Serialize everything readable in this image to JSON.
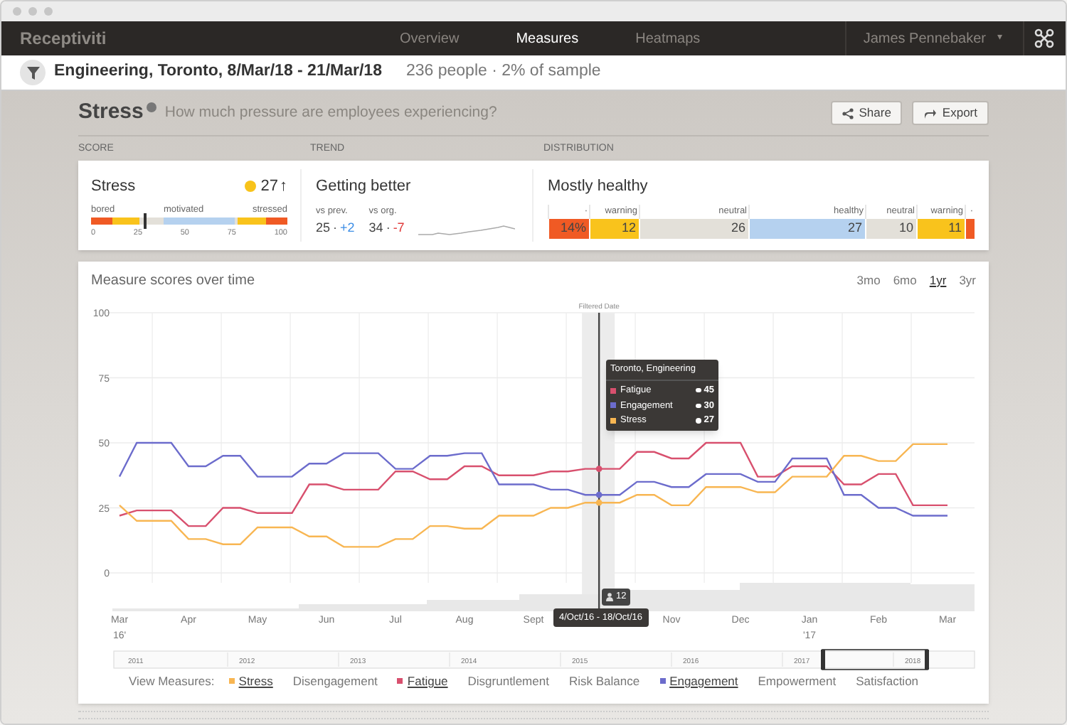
{
  "nav": {
    "logo": "Receptiviti",
    "tabs": [
      {
        "label": "Overview",
        "selected": false
      },
      {
        "label": "Measures",
        "selected": true
      },
      {
        "label": "Heatmaps",
        "selected": false
      }
    ],
    "user": "James Pennebaker",
    "caret": "▾"
  },
  "filter_bar": {
    "title": "Engineering, Toronto, 8/Mar/18 - 21/Mar/18",
    "summary": "236 people · 2% of sample"
  },
  "header": {
    "title": "Stress",
    "subtitle": "How much pressure are employees experiencing?",
    "buttons": [
      {
        "kind": "share",
        "label": "Share"
      },
      {
        "kind": "export",
        "label": "Export"
      }
    ]
  },
  "sections": [
    "SCORE",
    "TREND",
    "DISTRIBUTION"
  ],
  "score": {
    "title": "Stress",
    "value": "27",
    "arrow": "↑",
    "color": "#f8c31a",
    "labels": [
      "bored",
      "motivated",
      "stressed"
    ],
    "level": 0.27,
    "ticks": [
      "0",
      "25",
      "50",
      "75",
      "100"
    ]
  },
  "trend": {
    "title": "Getting better",
    "comparisons": [
      {
        "label": "vs prev.",
        "value": "25",
        "separator": "·",
        "delta": "+2",
        "color": "#3d8ee6"
      },
      {
        "label": "vs org.",
        "value": "34",
        "separator": "·",
        "delta": "-7",
        "color": "#e03b3b"
      }
    ]
  },
  "distribution": {
    "title": "Mostly healthy",
    "segments": [
      {
        "label": "·",
        "value": "14%",
        "color": "#f05a24"
      },
      {
        "label": "warning",
        "value": "12",
        "color": "#f9c31c"
      },
      {
        "label": "neutral",
        "value": "26",
        "color": "#e3e0d9"
      },
      {
        "label": "healthy",
        "value": "27",
        "color": "#b5d1ef"
      },
      {
        "label": "neutral",
        "value": "10",
        "color": "#e3e0d9"
      },
      {
        "label": "warning",
        "value": "11",
        "color": "#f9c31c"
      },
      {
        "label": "·",
        "color": "#f05a24"
      }
    ]
  },
  "chart": {
    "title": "Measure scores over time",
    "ranges": [
      {
        "label": "3mo",
        "selected": false
      },
      {
        "label": "6mo",
        "selected": false
      },
      {
        "label": "1yr",
        "selected": true
      },
      {
        "label": "3yr",
        "selected": false
      }
    ],
    "chart_data": {
      "type": "line",
      "categories": [
        "Mar",
        null,
        null,
        null,
        "Apr",
        null,
        null,
        null,
        "May",
        null,
        null,
        null,
        "Jun",
        null,
        null,
        null,
        "Jul",
        null,
        null,
        null,
        "Aug",
        null,
        null,
        null,
        "Sept",
        null,
        null,
        null,
        null,
        null,
        null,
        null,
        "Nov",
        null,
        null,
        null,
        "Dec",
        null,
        null,
        null,
        "Jan",
        null,
        null,
        null,
        "Feb",
        null,
        null,
        null,
        "Mar"
      ],
      "series": [
        {
          "name": "Fatigue",
          "color": "#d8506e",
          "values": [
            22,
            24,
            24,
            24,
            18,
            18,
            25,
            25,
            23,
            23,
            23,
            34,
            34,
            32,
            32,
            32,
            39,
            39,
            36,
            36,
            41,
            41,
            37.5,
            37.5,
            37.5,
            39,
            39,
            40,
            40,
            40,
            46.5,
            46.5,
            44,
            44,
            50,
            50,
            50,
            37,
            37,
            41,
            41,
            41,
            34,
            34,
            38,
            38,
            26,
            26,
            26
          ]
        },
        {
          "name": "Engagement",
          "color": "#6c6ccc",
          "values": [
            37,
            50,
            50,
            50,
            41,
            41,
            45,
            45,
            37,
            37,
            37,
            42,
            42,
            46,
            46,
            46,
            40,
            40,
            45,
            45,
            46,
            46,
            34,
            34,
            34,
            32,
            32,
            30,
            30,
            30,
            35,
            35,
            33,
            33,
            38,
            38,
            38,
            35,
            35,
            44,
            44,
            44,
            30,
            30,
            25,
            25,
            22,
            22,
            22
          ]
        },
        {
          "name": "Stress",
          "color": "#f8b652",
          "values": [
            26,
            20,
            20,
            20,
            13,
            13,
            11,
            11,
            17.5,
            17.5,
            17.5,
            14,
            14,
            10,
            10,
            10,
            13,
            13,
            18,
            18,
            17,
            17,
            22,
            22,
            22,
            25,
            25,
            27,
            27,
            27,
            30,
            30,
            26,
            26,
            33,
            33,
            33,
            31,
            31,
            37,
            37,
            37,
            45,
            45,
            43,
            43,
            49.5,
            49.5,
            49.5
          ]
        }
      ],
      "ylim": [
        0,
        100
      ],
      "yticks": [
        0,
        25,
        50,
        75,
        100
      ],
      "grid": true,
      "annotations": [
        "Filtered Date"
      ]
    },
    "year_labels": [
      "16'",
      "'17"
    ],
    "tooltip": {
      "title": "Toronto, Engineering",
      "values": [
        "45",
        "30",
        "27"
      ]
    },
    "date_badge": "4/Oct/16 - 18/Oct/16",
    "count_badge": "12",
    "timeline_years": [
      "2011",
      "2012",
      "2013",
      "2014",
      "2015",
      "2016",
      "2017",
      "2018"
    ],
    "legend": {
      "label": "View Measures:",
      "items": [
        {
          "name": "Stress",
          "selected": true,
          "color": "#f8b652"
        },
        {
          "name": "Disengagement",
          "selected": false
        },
        {
          "name": "Fatigue",
          "selected": true,
          "color": "#d8506e"
        },
        {
          "name": "Disgruntlement",
          "selected": false
        },
        {
          "name": "Risk Balance",
          "selected": false
        },
        {
          "name": "Engagement",
          "selected": true,
          "color": "#6c6ccc"
        },
        {
          "name": "Empowerment",
          "selected": false
        },
        {
          "name": "Satisfaction",
          "selected": false
        }
      ]
    }
  }
}
